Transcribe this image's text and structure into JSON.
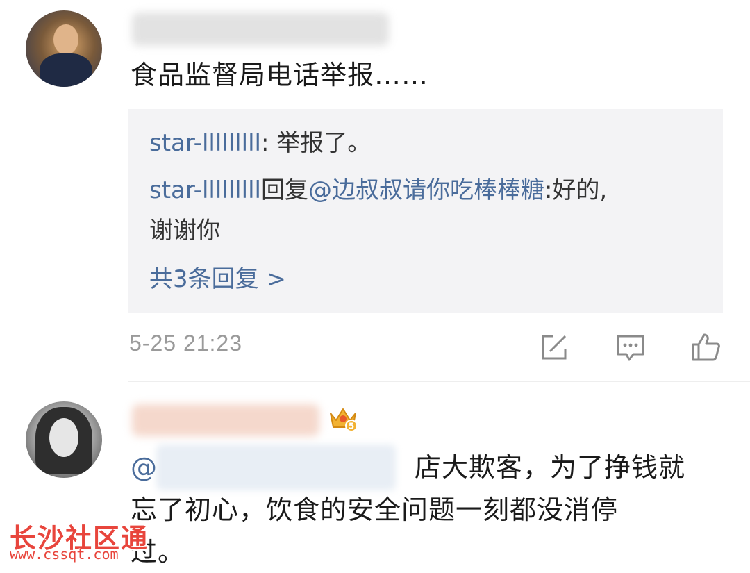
{
  "comment1": {
    "text": "食品监督局电话举报……",
    "replies": [
      {
        "user": "star-lllllllll",
        "sep": ": ",
        "text": "举报了。"
      },
      {
        "user": "star-lllllllll",
        "reply_word": "回复",
        "mention": "@边叔叔请你吃棒棒糖",
        "text_line1": ":好的,",
        "text_line2": "谢谢你"
      }
    ],
    "more_replies": "共3条回复 >",
    "timestamp": "5-25 21:23",
    "icons": [
      "share-icon",
      "comment-icon",
      "like-icon"
    ]
  },
  "comment2": {
    "badge_level": "5",
    "mention_prefix": "@",
    "line1_rest": "店大欺客，为了挣钱就",
    "line2": "忘了初心，饮食的安全问题一刻都没消停",
    "line3": "过。"
  },
  "watermark": {
    "title": "长沙社区通",
    "url": "www.cssqt.com"
  },
  "colors": {
    "link": "#4a6c9b",
    "reply_bg": "#f3f3f5",
    "timestamp": "#9a9a9a",
    "watermark": "#e8453c"
  }
}
